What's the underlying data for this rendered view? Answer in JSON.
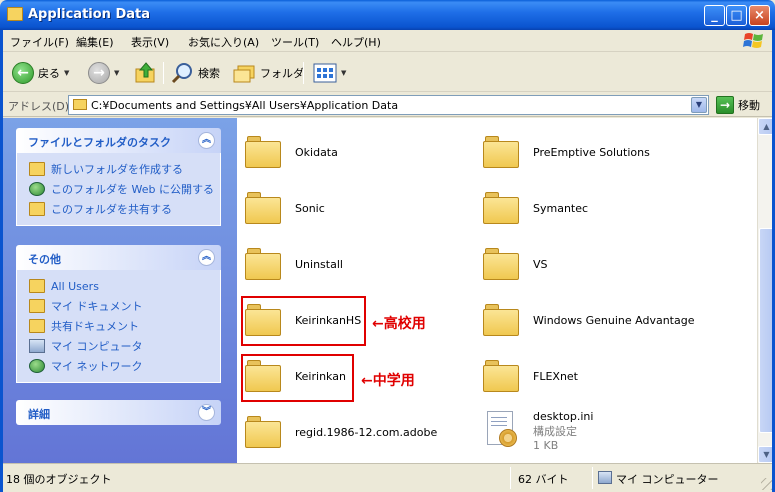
{
  "window": {
    "title": "Application Data",
    "minimize_glyph": "_",
    "maximize_glyph": "□",
    "close_glyph": "×"
  },
  "menu": [
    "ファイル(F)",
    "編集(E)",
    "表示(V)",
    "お気に入り(A)",
    "ツール(T)",
    "ヘルプ(H)"
  ],
  "toolbar": {
    "back_label": "戻る",
    "search_label": "検索",
    "folders_label": "フォルダ"
  },
  "address": {
    "label": "アドレス(D)",
    "path": "C:¥Documents and Settings¥All Users¥Application Data",
    "go_label": "移動"
  },
  "left_pane": {
    "tasks": {
      "title": "ファイルとフォルダのタスク",
      "items": [
        {
          "label": "新しいフォルダを作成する",
          "icon": "new-folder-icon"
        },
        {
          "label": "このフォルダを Web に公開する",
          "icon": "globe-icon"
        },
        {
          "label": "このフォルダを共有する",
          "icon": "share-folder-icon"
        }
      ]
    },
    "other": {
      "title": "その他",
      "items": [
        {
          "label": "All Users",
          "icon": "folder-icon"
        },
        {
          "label": "マイ ドキュメント",
          "icon": "folder-icon"
        },
        {
          "label": "共有ドキュメント",
          "icon": "folder-icon"
        },
        {
          "label": "マイ コンピュータ",
          "icon": "computer-icon"
        },
        {
          "label": "マイ ネットワーク",
          "icon": "network-icon"
        }
      ]
    },
    "details": {
      "title": "詳細"
    }
  },
  "files": {
    "col1": [
      "Okidata",
      "Sonic",
      "Uninstall",
      "KeirinkanHS",
      "Keirinkan",
      "regid.1986-12.com.adobe"
    ],
    "col2": [
      "PreEmptive Solutions",
      "Symantec",
      "VS",
      "Windows Genuine Advantage",
      "FLEXnet"
    ],
    "ini": {
      "name": "desktop.ini",
      "type": "構成設定",
      "size": "1 KB"
    }
  },
  "annotations": {
    "high_school": "←高校用",
    "junior_high": "←中学用",
    "color": "#e00000"
  },
  "status": {
    "objects": "18 個のオブジェクト",
    "size": "62 バイト",
    "location": "マイ コンピューター"
  }
}
